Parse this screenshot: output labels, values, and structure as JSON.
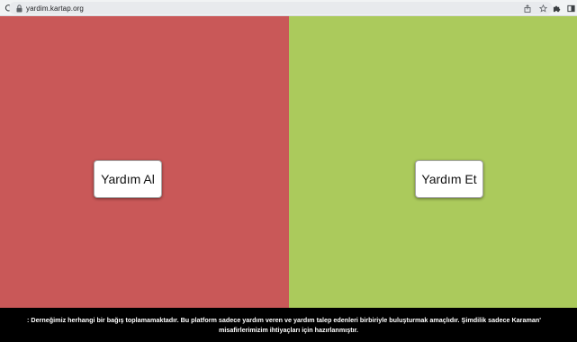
{
  "browser": {
    "url": "yardim.kartap.org",
    "icons": [
      "reload-icon",
      "lock-icon",
      "share-icon",
      "star-icon",
      "extensions-icon",
      "sidepanel-icon"
    ]
  },
  "colors": {
    "left_panel": "#c95858",
    "right_panel": "#abca5c",
    "footer_bg": "#000000",
    "footer_text": "#ffffff"
  },
  "main": {
    "left_button_label": "Yardım Al",
    "right_button_label": "Yardım Et"
  },
  "footer": {
    "line1": ": Derneğimiz herhangi bir bağış toplamamaktadır. Bu platform sadece yardım veren ve yardım talep edenleri birbiriyle buluşturmak amaçlıdır. Şimdilik sadece Karaman'",
    "line2": "misafirlerimizim ihtiyaçları için hazırlanmıştır."
  }
}
